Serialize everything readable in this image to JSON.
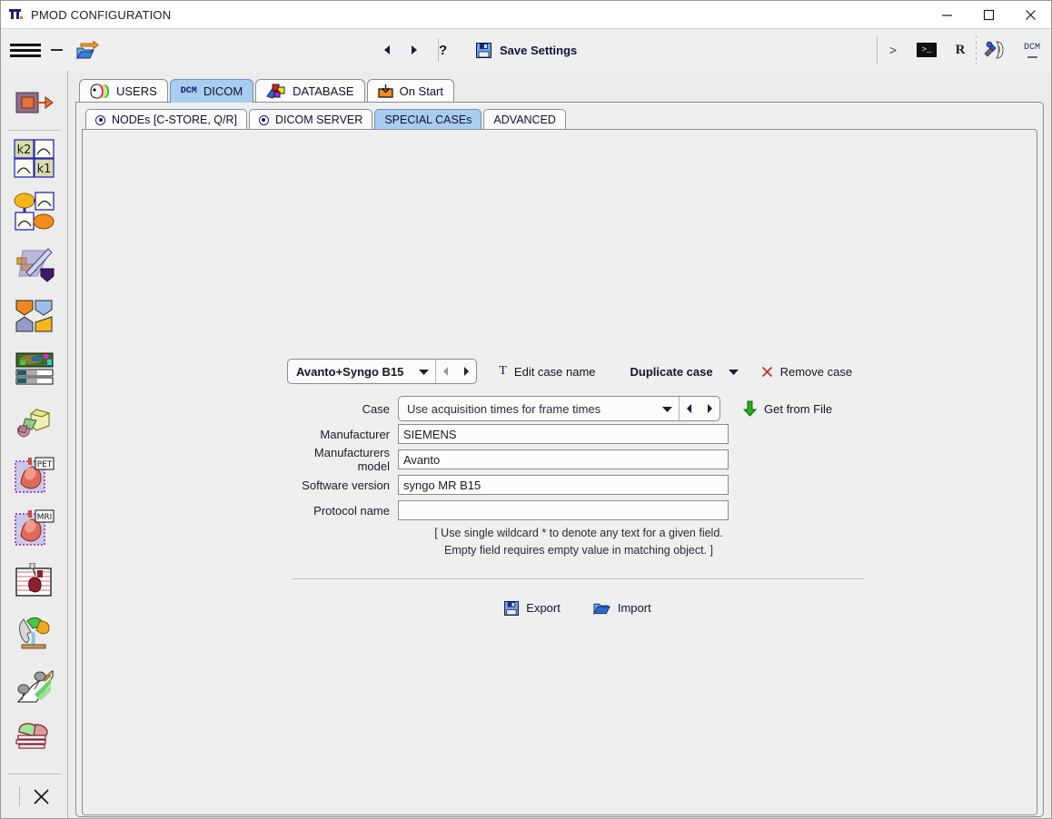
{
  "window": {
    "title": "PMOD CONFIGURATION",
    "app_icon": "pmod-logo-icon",
    "controls": {
      "minimize": "minimize-icon",
      "maximize": "maximize-icon",
      "close": "close-icon"
    }
  },
  "toolbar": {
    "menu_icon": "hamburger-menu-icon",
    "minus_icon": "minus-icon",
    "open_icon": "open-folder-arrow-icon",
    "prev_icon": "previous-arrow-icon",
    "next_icon": "next-arrow-icon",
    "help_label": "?",
    "save_icon": "floppy-disk-icon",
    "save_label": "Save Settings",
    "prompt_label": ">",
    "terminal_label": ">_",
    "r_label": "R",
    "tool_icon": "config-tools-icon",
    "dcm_label": "DCM"
  },
  "sidebar": {
    "items": [
      {
        "name": "sidebar-item-kinetic-modeling",
        "icon": "module-pixelwise-icon"
      },
      {
        "name": "sidebar-item-k2-k1",
        "icon": "module-k2k1-icon"
      },
      {
        "name": "sidebar-item-compartment",
        "icon": "module-compartment-icon"
      },
      {
        "name": "sidebar-item-fusion",
        "icon": "module-fusion-icon"
      },
      {
        "name": "sidebar-item-segmentation",
        "icon": "module-segmentation-icon"
      },
      {
        "name": "sidebar-item-colorscale",
        "icon": "module-colorscale-icon"
      },
      {
        "name": "sidebar-item-3d-rendering",
        "icon": "module-3d-icon"
      },
      {
        "name": "sidebar-item-cardiac-pet",
        "icon": "module-cardiac-pet-icon",
        "badge": "PET"
      },
      {
        "name": "sidebar-item-cardiac-mri",
        "icon": "module-cardiac-mri-icon",
        "badge": "MRI"
      },
      {
        "name": "sidebar-item-cardiac-perfusion",
        "icon": "module-cardiac-perfusion-icon"
      },
      {
        "name": "sidebar-item-neuro",
        "icon": "module-neuro-icon"
      },
      {
        "name": "sidebar-item-statistics",
        "icon": "module-statistics-icon"
      },
      {
        "name": "sidebar-item-database-stack",
        "icon": "module-stack-icon"
      }
    ],
    "close_icon": "close-x-icon"
  },
  "tabs": {
    "outer": [
      {
        "label": "USERS",
        "icon": "users-icon",
        "selected": false,
        "dcm": ""
      },
      {
        "label": "DICOM",
        "icon": "dcm-text-icon",
        "selected": true,
        "dcm": "DCM"
      },
      {
        "label": "DATABASE",
        "icon": "database-icon",
        "selected": false,
        "dcm": ""
      },
      {
        "label": "On Start",
        "icon": "on-start-icon",
        "selected": false,
        "dcm": ""
      }
    ],
    "inner": [
      {
        "label": "NODEs [C-STORE, Q/R]",
        "icon": "radio-dot-icon",
        "selected": false
      },
      {
        "label": "DICOM SERVER",
        "icon": "radio-dot-icon",
        "selected": false
      },
      {
        "label": "SPECIAL CASEs",
        "icon": "",
        "selected": true
      },
      {
        "label": "ADVANCED",
        "icon": "",
        "selected": false
      }
    ]
  },
  "form": {
    "case_selector": {
      "value": "Avanto+Syngo B15",
      "chevron": "chevron-down-icon",
      "prev": "previous-arrow-icon",
      "next": "next-arrow-icon"
    },
    "edit_case_name": {
      "label": "Edit case name",
      "icon": "text-T-icon"
    },
    "duplicate_case": {
      "label": "Duplicate case",
      "chevron": "chevron-down-icon"
    },
    "remove_case": {
      "label": "Remove case",
      "icon": "red-x-icon"
    },
    "get_from_file": {
      "label": "Get from File",
      "icon": "green-down-arrow-icon"
    },
    "fields": [
      {
        "label": "Case",
        "value": "Use acquisition times for frame times",
        "type": "combo"
      },
      {
        "label": "Manufacturer",
        "value": "SIEMENS",
        "type": "text"
      },
      {
        "label": "Manufacturers model",
        "value": "Avanto",
        "type": "text"
      },
      {
        "label": "Software version",
        "value": "syngo MR B15",
        "type": "text"
      },
      {
        "label": "Protocol name",
        "value": "",
        "type": "text"
      }
    ],
    "hint_line1": "[ Use single wildcard * to denote any text for a given field.",
    "hint_line2": "Empty field requires empty value in matching object. ]",
    "export": {
      "label": "Export",
      "icon": "floppy-disk-icon"
    },
    "import": {
      "label": "Import",
      "icon": "open-folder-icon"
    }
  },
  "colors": {
    "tab_selected": "#a9cdee",
    "accent_blue": "#15157a",
    "red": "#cc2222",
    "green": "#1fae1f",
    "orange": "#f08a1e"
  }
}
